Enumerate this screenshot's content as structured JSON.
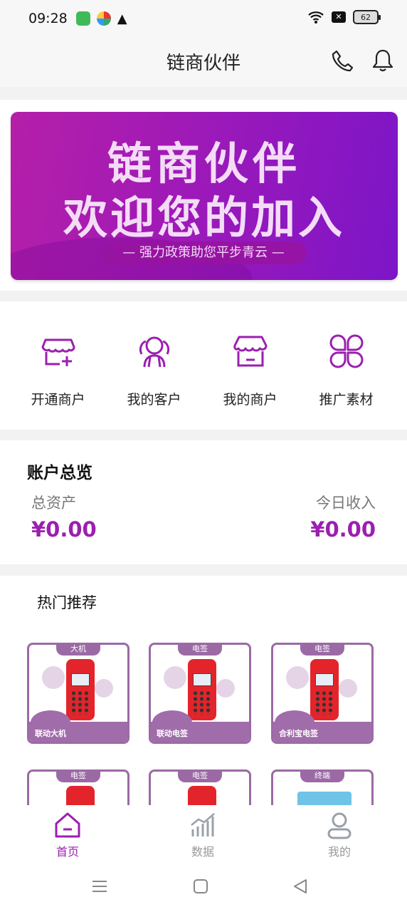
{
  "status_bar": {
    "time": "09:28",
    "battery": "62"
  },
  "header": {
    "title": "链商伙伴"
  },
  "banner": {
    "line1": "链商伙伴",
    "line2": "欢迎您的加入",
    "slogan": "— 强力政策助您平步青云 —"
  },
  "quick_actions": [
    {
      "label": "开通商户",
      "icon": "store-add-icon"
    },
    {
      "label": "我的客户",
      "icon": "customers-icon"
    },
    {
      "label": "我的商户",
      "icon": "shop-icon"
    },
    {
      "label": "推广素材",
      "icon": "grid-clover-icon"
    }
  ],
  "account": {
    "title": "账户总览",
    "total_assets_label": "总资产",
    "total_assets_value": "¥0.00",
    "today_income_label": "今日收入",
    "today_income_value": "¥0.00"
  },
  "hot": {
    "title": "热门推荐",
    "products": [
      {
        "tag": "大机",
        "name": "联动大机"
      },
      {
        "tag": "电签",
        "name": "联动电签"
      },
      {
        "tag": "电签",
        "name": "合利宝电签"
      },
      {
        "tag": "电签",
        "name": ""
      },
      {
        "tag": "电签",
        "name": ""
      },
      {
        "tag": "终端",
        "name": ""
      }
    ]
  },
  "tabbar": {
    "active_color": "#9b1fb0",
    "inactive_color": "#999999",
    "tabs": [
      {
        "label": "首页",
        "active": true
      },
      {
        "label": "数据",
        "active": false
      },
      {
        "label": "我的",
        "active": false
      }
    ]
  }
}
